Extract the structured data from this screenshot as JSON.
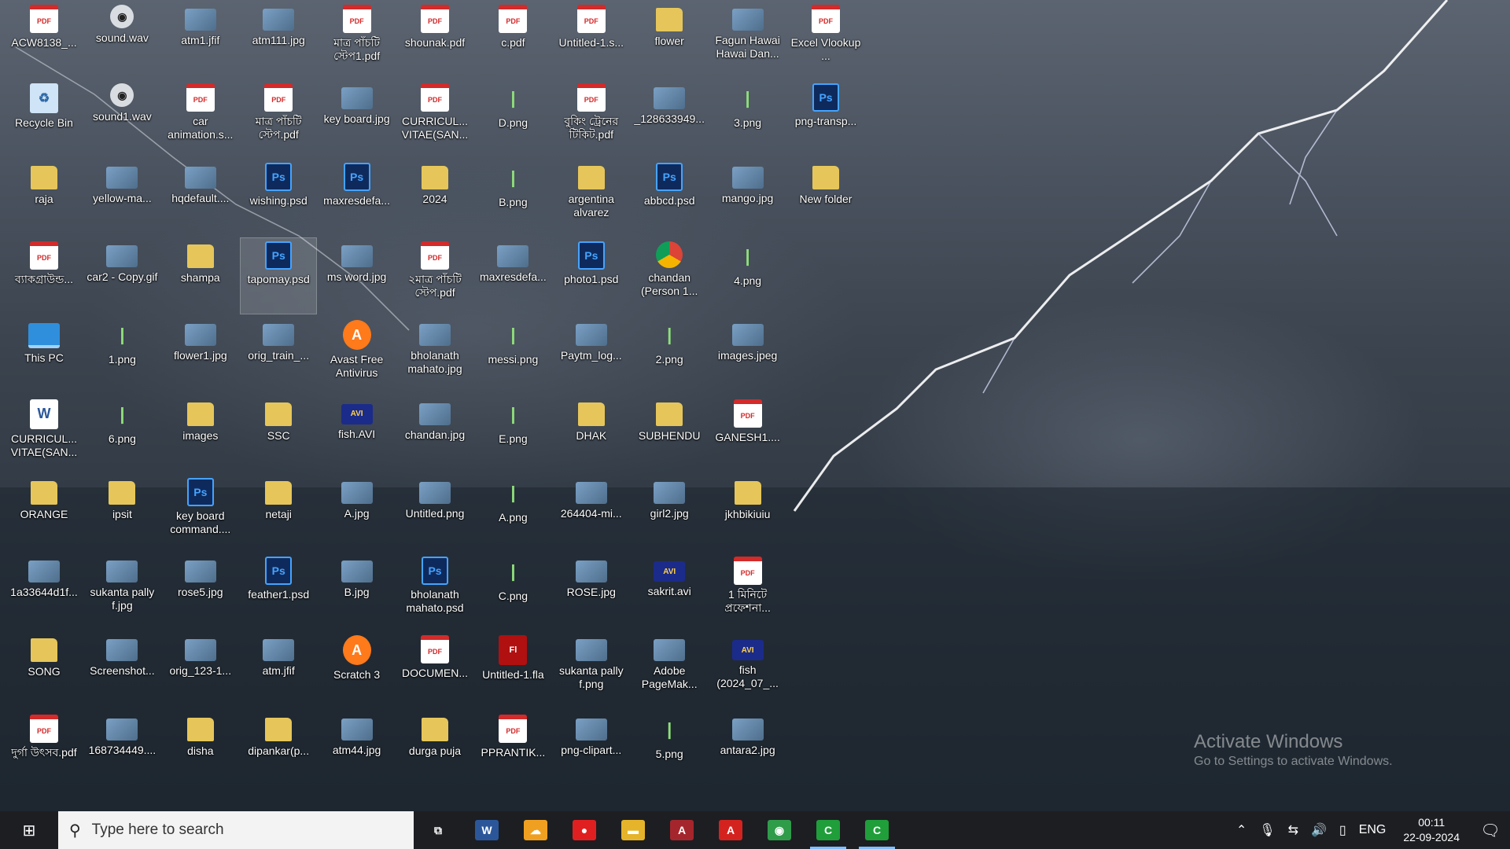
{
  "desktop": {
    "icons": [
      {
        "label": "ACW8138_...",
        "type": "pdf",
        "col": 0,
        "row": 0
      },
      {
        "label": "sound.wav",
        "type": "wav",
        "col": 1,
        "row": 0
      },
      {
        "label": "atm1.jfif",
        "type": "img",
        "col": 2,
        "row": 0
      },
      {
        "label": "atm111.jpg",
        "type": "img",
        "col": 3,
        "row": 0
      },
      {
        "label": "মাত্র পাঁচটি স্টেপ1.pdf",
        "type": "pdf",
        "col": 4,
        "row": 0
      },
      {
        "label": "shounak.pdf",
        "type": "pdf",
        "col": 5,
        "row": 0
      },
      {
        "label": "c.pdf",
        "type": "pdf",
        "col": 6,
        "row": 0
      },
      {
        "label": "Untitled-1.s...",
        "type": "pdf",
        "col": 7,
        "row": 0
      },
      {
        "label": "flower",
        "type": "folder",
        "col": 8,
        "row": 0
      },
      {
        "label": "Fagun Hawai Hawai Dan...",
        "type": "img",
        "col": 9,
        "row": 0
      },
      {
        "label": "Excel Vlookup ...",
        "type": "pdf",
        "col": 10,
        "row": 0
      },
      {
        "label": "Recycle Bin",
        "type": "bin",
        "col": 0,
        "row": 1
      },
      {
        "label": "sound1.wav",
        "type": "wav",
        "col": 1,
        "row": 1
      },
      {
        "label": "car animation.s...",
        "type": "pdf",
        "col": 2,
        "row": 1
      },
      {
        "label": "মাত্র পাঁচটি স্টেপ.pdf",
        "type": "pdf",
        "col": 3,
        "row": 1
      },
      {
        "label": "key board.jpg",
        "type": "img",
        "col": 4,
        "row": 1
      },
      {
        "label": "CURRICUL... VITAE(SAN...",
        "type": "pdf",
        "col": 5,
        "row": 1
      },
      {
        "label": "D.png",
        "type": "png",
        "col": 6,
        "row": 1
      },
      {
        "label": "বুকিং ট্রেনের টিকিট.pdf",
        "type": "pdf",
        "col": 7,
        "row": 1
      },
      {
        "label": "_128633949...",
        "type": "img",
        "col": 8,
        "row": 1
      },
      {
        "label": "3.png",
        "type": "png",
        "col": 9,
        "row": 1
      },
      {
        "label": "png-transp...",
        "type": "psd",
        "col": 10,
        "row": 1
      },
      {
        "label": "raja",
        "type": "folder",
        "col": 0,
        "row": 2
      },
      {
        "label": "yellow-ma...",
        "type": "img",
        "col": 1,
        "row": 2
      },
      {
        "label": "hqdefault....",
        "type": "img",
        "col": 2,
        "row": 2
      },
      {
        "label": "wishing.psd",
        "type": "psd",
        "col": 3,
        "row": 2
      },
      {
        "label": "maxresdefa...",
        "type": "psd",
        "col": 4,
        "row": 2
      },
      {
        "label": "2024",
        "type": "folder",
        "col": 5,
        "row": 2
      },
      {
        "label": "B.png",
        "type": "png",
        "col": 6,
        "row": 2
      },
      {
        "label": "argentina alvarez",
        "type": "folder",
        "col": 7,
        "row": 2
      },
      {
        "label": "abbcd.psd",
        "type": "psd",
        "col": 8,
        "row": 2
      },
      {
        "label": "mango.jpg",
        "type": "img",
        "col": 9,
        "row": 2
      },
      {
        "label": "New folder",
        "type": "folder",
        "col": 10,
        "row": 2
      },
      {
        "label": "ব্যাকগ্রাউন্ড...",
        "type": "pdf",
        "col": 0,
        "row": 3
      },
      {
        "label": "car2 - Copy.gif",
        "type": "img",
        "col": 1,
        "row": 3
      },
      {
        "label": "shampa",
        "type": "folder",
        "col": 2,
        "row": 3
      },
      {
        "label": "tapomay.psd",
        "type": "psd",
        "col": 3,
        "row": 3,
        "selected": true
      },
      {
        "label": "ms word.jpg",
        "type": "img",
        "col": 4,
        "row": 3
      },
      {
        "label": "২মাত্র পাঁচটি স্টেপ.pdf",
        "type": "pdf",
        "col": 5,
        "row": 3
      },
      {
        "label": "maxresdefa...",
        "type": "img",
        "col": 6,
        "row": 3
      },
      {
        "label": "photo1.psd",
        "type": "psd",
        "col": 7,
        "row": 3
      },
      {
        "label": "chandan (Person 1...",
        "type": "chrome",
        "col": 8,
        "row": 3
      },
      {
        "label": "4.png",
        "type": "png",
        "col": 9,
        "row": 3
      },
      {
        "label": "This PC",
        "type": "pc",
        "col": 0,
        "row": 4
      },
      {
        "label": "1.png",
        "type": "png",
        "col": 1,
        "row": 4
      },
      {
        "label": "flower1.jpg",
        "type": "img",
        "col": 2,
        "row": 4
      },
      {
        "label": "orig_train_...",
        "type": "img",
        "col": 3,
        "row": 4
      },
      {
        "label": "Avast Free Antivirus",
        "type": "app",
        "col": 4,
        "row": 4
      },
      {
        "label": "bholanath mahato.jpg",
        "type": "img",
        "col": 5,
        "row": 4
      },
      {
        "label": "messi.png",
        "type": "png",
        "col": 6,
        "row": 4
      },
      {
        "label": "Paytm_log...",
        "type": "img",
        "col": 7,
        "row": 4
      },
      {
        "label": "2.png",
        "type": "png",
        "col": 8,
        "row": 4
      },
      {
        "label": "images.jpeg",
        "type": "img",
        "col": 9,
        "row": 4
      },
      {
        "label": "CURRICUL... VITAE(SAN...",
        "type": "doc",
        "col": 0,
        "row": 5
      },
      {
        "label": "6.png",
        "type": "png",
        "col": 1,
        "row": 5
      },
      {
        "label": "images",
        "type": "folder",
        "col": 2,
        "row": 5
      },
      {
        "label": "SSC",
        "type": "folder",
        "col": 3,
        "row": 5
      },
      {
        "label": "fish.AVI",
        "type": "vid",
        "col": 4,
        "row": 5
      },
      {
        "label": "chandan.jpg",
        "type": "img",
        "col": 5,
        "row": 5
      },
      {
        "label": "E.png",
        "type": "png",
        "col": 6,
        "row": 5
      },
      {
        "label": "DHAK",
        "type": "folder",
        "col": 7,
        "row": 5
      },
      {
        "label": "SUBHENDU",
        "type": "folder",
        "col": 8,
        "row": 5
      },
      {
        "label": "GANESH1....",
        "type": "pdf",
        "col": 9,
        "row": 5
      },
      {
        "label": "ORANGE",
        "type": "folder",
        "col": 0,
        "row": 6
      },
      {
        "label": "ipsit",
        "type": "folder",
        "col": 1,
        "row": 6
      },
      {
        "label": "key board command....",
        "type": "psd",
        "col": 2,
        "row": 6
      },
      {
        "label": "netaji",
        "type": "folder",
        "col": 3,
        "row": 6
      },
      {
        "label": "A.jpg",
        "type": "img",
        "col": 4,
        "row": 6
      },
      {
        "label": "Untitled.png",
        "type": "img",
        "col": 5,
        "row": 6
      },
      {
        "label": "A.png",
        "type": "png",
        "col": 6,
        "row": 6
      },
      {
        "label": "264404-mi...",
        "type": "img",
        "col": 7,
        "row": 6
      },
      {
        "label": "girl2.jpg",
        "type": "img",
        "col": 8,
        "row": 6
      },
      {
        "label": "jkhbikiuiu",
        "type": "folder",
        "col": 9,
        "row": 6
      },
      {
        "label": "1a33644d1f...",
        "type": "img",
        "col": 0,
        "row": 7
      },
      {
        "label": "sukanta pally f.jpg",
        "type": "img",
        "col": 1,
        "row": 7
      },
      {
        "label": "rose5.jpg",
        "type": "img",
        "col": 2,
        "row": 7
      },
      {
        "label": "feather1.psd",
        "type": "psd",
        "col": 3,
        "row": 7
      },
      {
        "label": "B.jpg",
        "type": "img",
        "col": 4,
        "row": 7
      },
      {
        "label": "bholanath mahato.psd",
        "type": "psd",
        "col": 5,
        "row": 7
      },
      {
        "label": "C.png",
        "type": "png",
        "col": 6,
        "row": 7
      },
      {
        "label": "ROSE.jpg",
        "type": "img",
        "col": 7,
        "row": 7
      },
      {
        "label": "sakrit.avi",
        "type": "vid",
        "col": 8,
        "row": 7
      },
      {
        "label": "1 মিনিটে প্রফেশনা...",
        "type": "pdf",
        "col": 9,
        "row": 7
      },
      {
        "label": "SONG",
        "type": "folder",
        "col": 0,
        "row": 8
      },
      {
        "label": "Screenshot...",
        "type": "img",
        "col": 1,
        "row": 8
      },
      {
        "label": "orig_123-1...",
        "type": "img",
        "col": 2,
        "row": 8
      },
      {
        "label": "atm.jfif",
        "type": "img",
        "col": 3,
        "row": 8
      },
      {
        "label": "Scratch 3",
        "type": "app",
        "col": 4,
        "row": 8
      },
      {
        "label": "DOCUMEN...",
        "type": "pdf",
        "col": 5,
        "row": 8
      },
      {
        "label": "Untitled-1.fla",
        "type": "fla",
        "col": 6,
        "row": 8
      },
      {
        "label": "sukanta pally f.png",
        "type": "img",
        "col": 7,
        "row": 8
      },
      {
        "label": "Adobe PageMak...",
        "type": "img",
        "col": 8,
        "row": 8
      },
      {
        "label": "fish (2024_07_...",
        "type": "vid",
        "col": 9,
        "row": 8
      },
      {
        "label": "দুর্গা উৎসব.pdf",
        "type": "pdf",
        "col": 0,
        "row": 9
      },
      {
        "label": "168734449....",
        "type": "img",
        "col": 1,
        "row": 9
      },
      {
        "label": "disha",
        "type": "folder",
        "col": 2,
        "row": 9
      },
      {
        "label": "dipankar(p...",
        "type": "folder",
        "col": 3,
        "row": 9
      },
      {
        "label": "atm44.jpg",
        "type": "img",
        "col": 4,
        "row": 9
      },
      {
        "label": "durga puja",
        "type": "folder",
        "col": 5,
        "row": 9
      },
      {
        "label": "PPRANTIK...",
        "type": "pdf",
        "col": 6,
        "row": 9
      },
      {
        "label": "png-clipart...",
        "type": "img",
        "col": 7,
        "row": 9
      },
      {
        "label": "5.png",
        "type": "png",
        "col": 8,
        "row": 9
      },
      {
        "label": "antara2.jpg",
        "type": "img",
        "col": 9,
        "row": 9
      }
    ]
  },
  "watermark": {
    "title": "Activate Windows",
    "subtitle": "Go to Settings to activate Windows."
  },
  "taskbar": {
    "search_placeholder": "Type here to search",
    "pinned": [
      {
        "name": "task-view",
        "glyph": "⧉",
        "bg": "transparent"
      },
      {
        "name": "word",
        "glyph": "W",
        "bg": "#2b579a"
      },
      {
        "name": "weather",
        "glyph": "☁",
        "bg": "#f0a020"
      },
      {
        "name": "screen-recorder",
        "glyph": "●",
        "bg": "#e02020"
      },
      {
        "name": "file-explorer",
        "glyph": "▬",
        "bg": "#e6b42a"
      },
      {
        "name": "access",
        "glyph": "A",
        "bg": "#a4262c"
      },
      {
        "name": "acrobat",
        "glyph": "A",
        "bg": "#d4231f"
      },
      {
        "name": "chrome",
        "glyph": "◉",
        "bg": "#2f9c4a"
      },
      {
        "name": "camtasia-1",
        "glyph": "C",
        "bg": "#1f9e3a",
        "active": true
      },
      {
        "name": "camtasia-2",
        "glyph": "C",
        "bg": "#1f9e3a",
        "active": true
      }
    ],
    "tray": {
      "language": "ENG",
      "time": "00:11",
      "date": "22-09-2024"
    }
  }
}
